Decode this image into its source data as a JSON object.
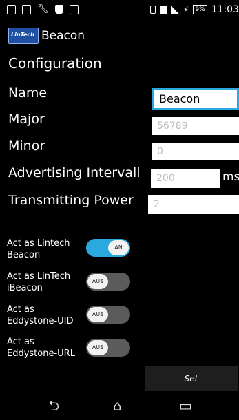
{
  "status_bar": {
    "battery_percent": "9%",
    "time": "11:03",
    "icons": [
      "storage-icon",
      "checklist-icon",
      "wrench-icon",
      "shield-icon",
      "image-icon",
      "vibrate-icon",
      "sim-icon",
      "signal-icon",
      "charging-icon"
    ]
  },
  "action_bar": {
    "logo_text": "LinTech",
    "title": "Beacon"
  },
  "config": {
    "section_title": "Configuration",
    "name_label": "Name",
    "name_value": "Beacon",
    "major_label": "Major",
    "major_placeholder": "56789",
    "minor_label": "Minor",
    "minor_placeholder": "0",
    "interval_label": "Advertising Intervall",
    "interval_placeholder": "200",
    "interval_unit": "ms",
    "power_label": "Transmitting Power",
    "power_placeholder": "2"
  },
  "toggles": [
    {
      "label": "Act as Lintech Beacon",
      "state": "AN",
      "on": true
    },
    {
      "label": "Act as LinTech iBeacon",
      "state": "AUS",
      "on": false
    },
    {
      "label": "Act as Eddystone-UID",
      "state": "AUS",
      "on": false
    },
    {
      "label": "Act as Eddystone-URL",
      "state": "AUS",
      "on": false
    }
  ],
  "set_button": "Set",
  "nav": {
    "back_icon": "back-arrow-icon",
    "home_icon": "home-icon",
    "recents_icon": "recent-apps-icon"
  }
}
